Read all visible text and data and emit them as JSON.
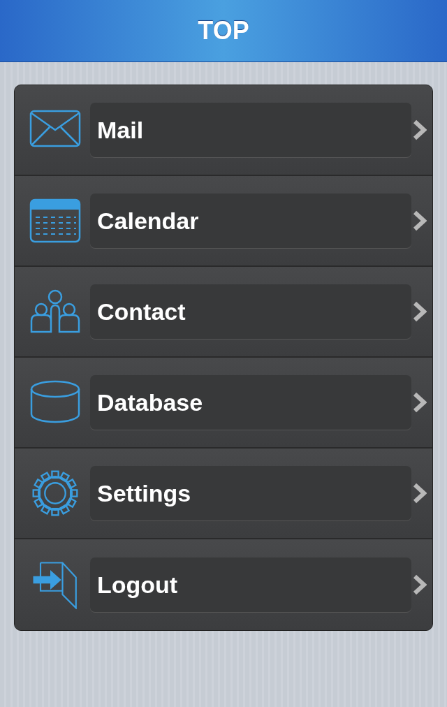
{
  "header": {
    "title": "TOP"
  },
  "menu": [
    {
      "kind": "mail",
      "label": "Mail"
    },
    {
      "kind": "calendar",
      "label": "Calendar"
    },
    {
      "kind": "contact",
      "label": "Contact"
    },
    {
      "kind": "database",
      "label": "Database"
    },
    {
      "kind": "settings",
      "label": "Settings"
    },
    {
      "kind": "logout",
      "label": "Logout"
    }
  ]
}
